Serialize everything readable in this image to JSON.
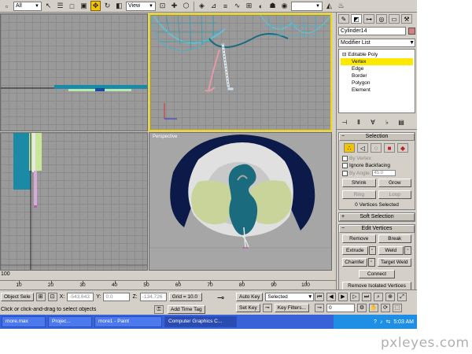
{
  "toolbar": {
    "filter_value": "All",
    "view_value": "View"
  },
  "viewports": {
    "perspective_label": "Perspective"
  },
  "command_panel": {
    "object_name": "Cylinder14",
    "modifier_list": "Modifier List",
    "stack": {
      "root": "Editable Poly",
      "items": [
        "Vertex",
        "Edge",
        "Border",
        "Polygon",
        "Element"
      ],
      "selected_index": 0
    },
    "selection_rollout": {
      "title": "Selection",
      "by_vertex": "By Vertex",
      "ignore_backfacing": "Ignore Backfacing",
      "by_angle": "By Angle:",
      "by_angle_value": "45.0",
      "shrink": "Shrink",
      "grow": "Grow",
      "ring": "Ring",
      "loop": "Loop",
      "status": "0 Vertices Selected"
    },
    "soft_selection_title": "Soft Selection",
    "edit_vertices": {
      "title": "Edit Vertices",
      "remove": "Remove",
      "break": "Break",
      "extrude": "Extrude",
      "weld": "Weld",
      "chamfer": "Chamfer",
      "target_weld": "Target Weld",
      "connect": "Connect",
      "remove_isolated": "Remove Isolated Vertices"
    }
  },
  "timeline": {
    "left_label": "100",
    "ticks": [
      "10",
      "20",
      "30",
      "40",
      "50",
      "60",
      "70",
      "80",
      "90",
      "100"
    ]
  },
  "status_bar": {
    "object_sel": "Object Sele",
    "x_label": "X:",
    "x_value": "-543.643",
    "y_label": "Y:",
    "y_value": "0.0",
    "z_label": "Z:",
    "z_value": "-134.726",
    "grid": "Grid = 10.0",
    "add_time_tag": "Add Time Tag",
    "auto_key": "Auto Key",
    "set_key": "Set Key",
    "selected": "Selected",
    "key_filters": "Key Filters...",
    "frame": "0",
    "prompt": "Click or click-and-drag to select objects"
  },
  "taskbar": {
    "tasks": [
      "more.max",
      "Projec...",
      "more1 - Paint",
      "Computer Graphics C..."
    ],
    "active_index": 3,
    "time": "5:03 AM"
  },
  "watermark": "pxleyes.com",
  "colors": {
    "panel_bg": "#d4d0c8",
    "viewport_bg": "#9a9a9a",
    "active_border": "#f0d800",
    "teal": "#1a6b7e",
    "navy": "#0c1a4a",
    "olive": "#c8d49a",
    "taskbar": "#3a62d8"
  }
}
